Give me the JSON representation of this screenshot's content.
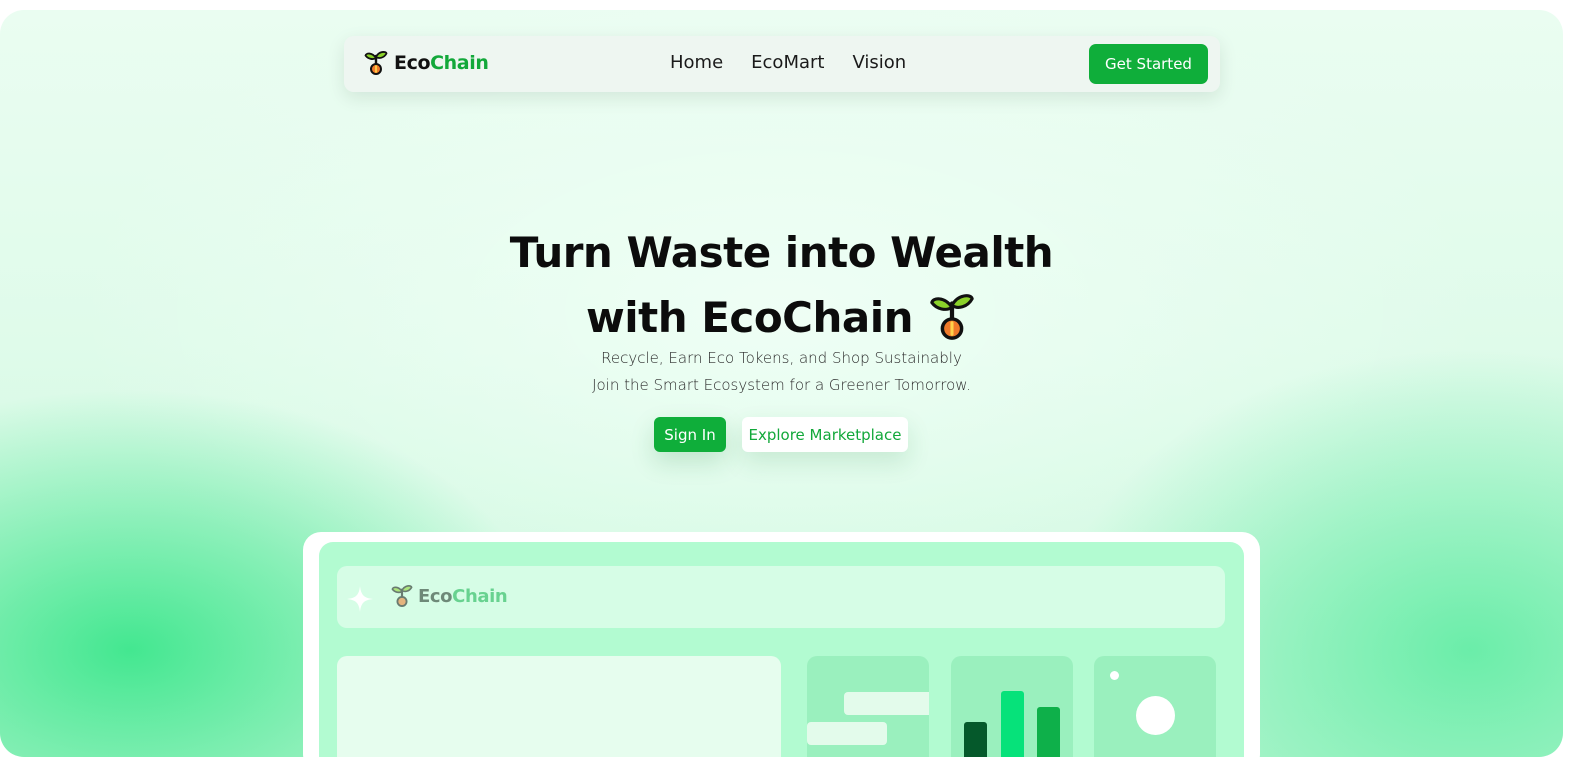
{
  "brand": {
    "eco": "Eco",
    "chain": "Chain"
  },
  "nav": {
    "links": [
      "Home",
      "EcoMart",
      "Vision"
    ],
    "cta_label": "Get Started"
  },
  "hero": {
    "title_line1": "Turn Waste into Wealth",
    "title_line2": "with EcoChain",
    "subtitle_line1": "Recycle, Earn Eco Tokens, and Shop Sustainably",
    "subtitle_line2": "Join the Smart Ecosystem for a Greener Tomorrow.",
    "primary_button": "Sign In",
    "secondary_button": "Explore Marketplace"
  },
  "preview": {
    "brand": {
      "eco": "Eco",
      "chain": "Chain"
    }
  },
  "icons": {
    "logo": "sprout-icon",
    "hero": "sprout-icon",
    "preview_header": "sparkle-icon"
  },
  "colors": {
    "accent": "#0fae3a",
    "brand_chain": "#12a83a",
    "bar_dark": "#05592b",
    "bar_bright": "#06e27a",
    "bar_mid": "#0eb04a"
  }
}
